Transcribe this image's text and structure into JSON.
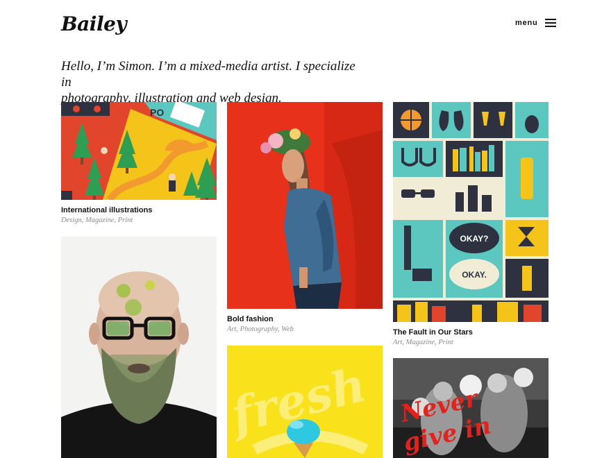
{
  "header": {
    "logo": "Bailey",
    "menu_label": "menu"
  },
  "intro": {
    "line1": "Hello, I’m Simon. I’m a mixed-media artist. I specialize in",
    "line2": "photography, illustration and web design."
  },
  "projects": [
    {
      "title": "International illustrations",
      "tags": "Design, Magazine, Print"
    },
    {
      "title": "Bold fashion",
      "tags": "Art, Photography, Web"
    },
    {
      "title": "The Fault in Our Stars",
      "tags": "Art, Magazine, Print"
    },
    {
      "title": "",
      "tags": ""
    },
    {
      "title": "",
      "tags": ""
    },
    {
      "title": "",
      "tags": ""
    }
  ],
  "artwork_text": {
    "sign": "PO",
    "cloud_top": "OKAY?",
    "cloud_bottom": "OKAY.",
    "lettering": "fresh",
    "boxing_line1": "Never",
    "boxing_line2": "give in"
  },
  "colors": {
    "text": "#111111",
    "muted": "#8c8c8c",
    "teal": "#5cc7bf",
    "navy": "#2e3240",
    "red": "#e1452b",
    "yellow": "#f5c41a"
  }
}
